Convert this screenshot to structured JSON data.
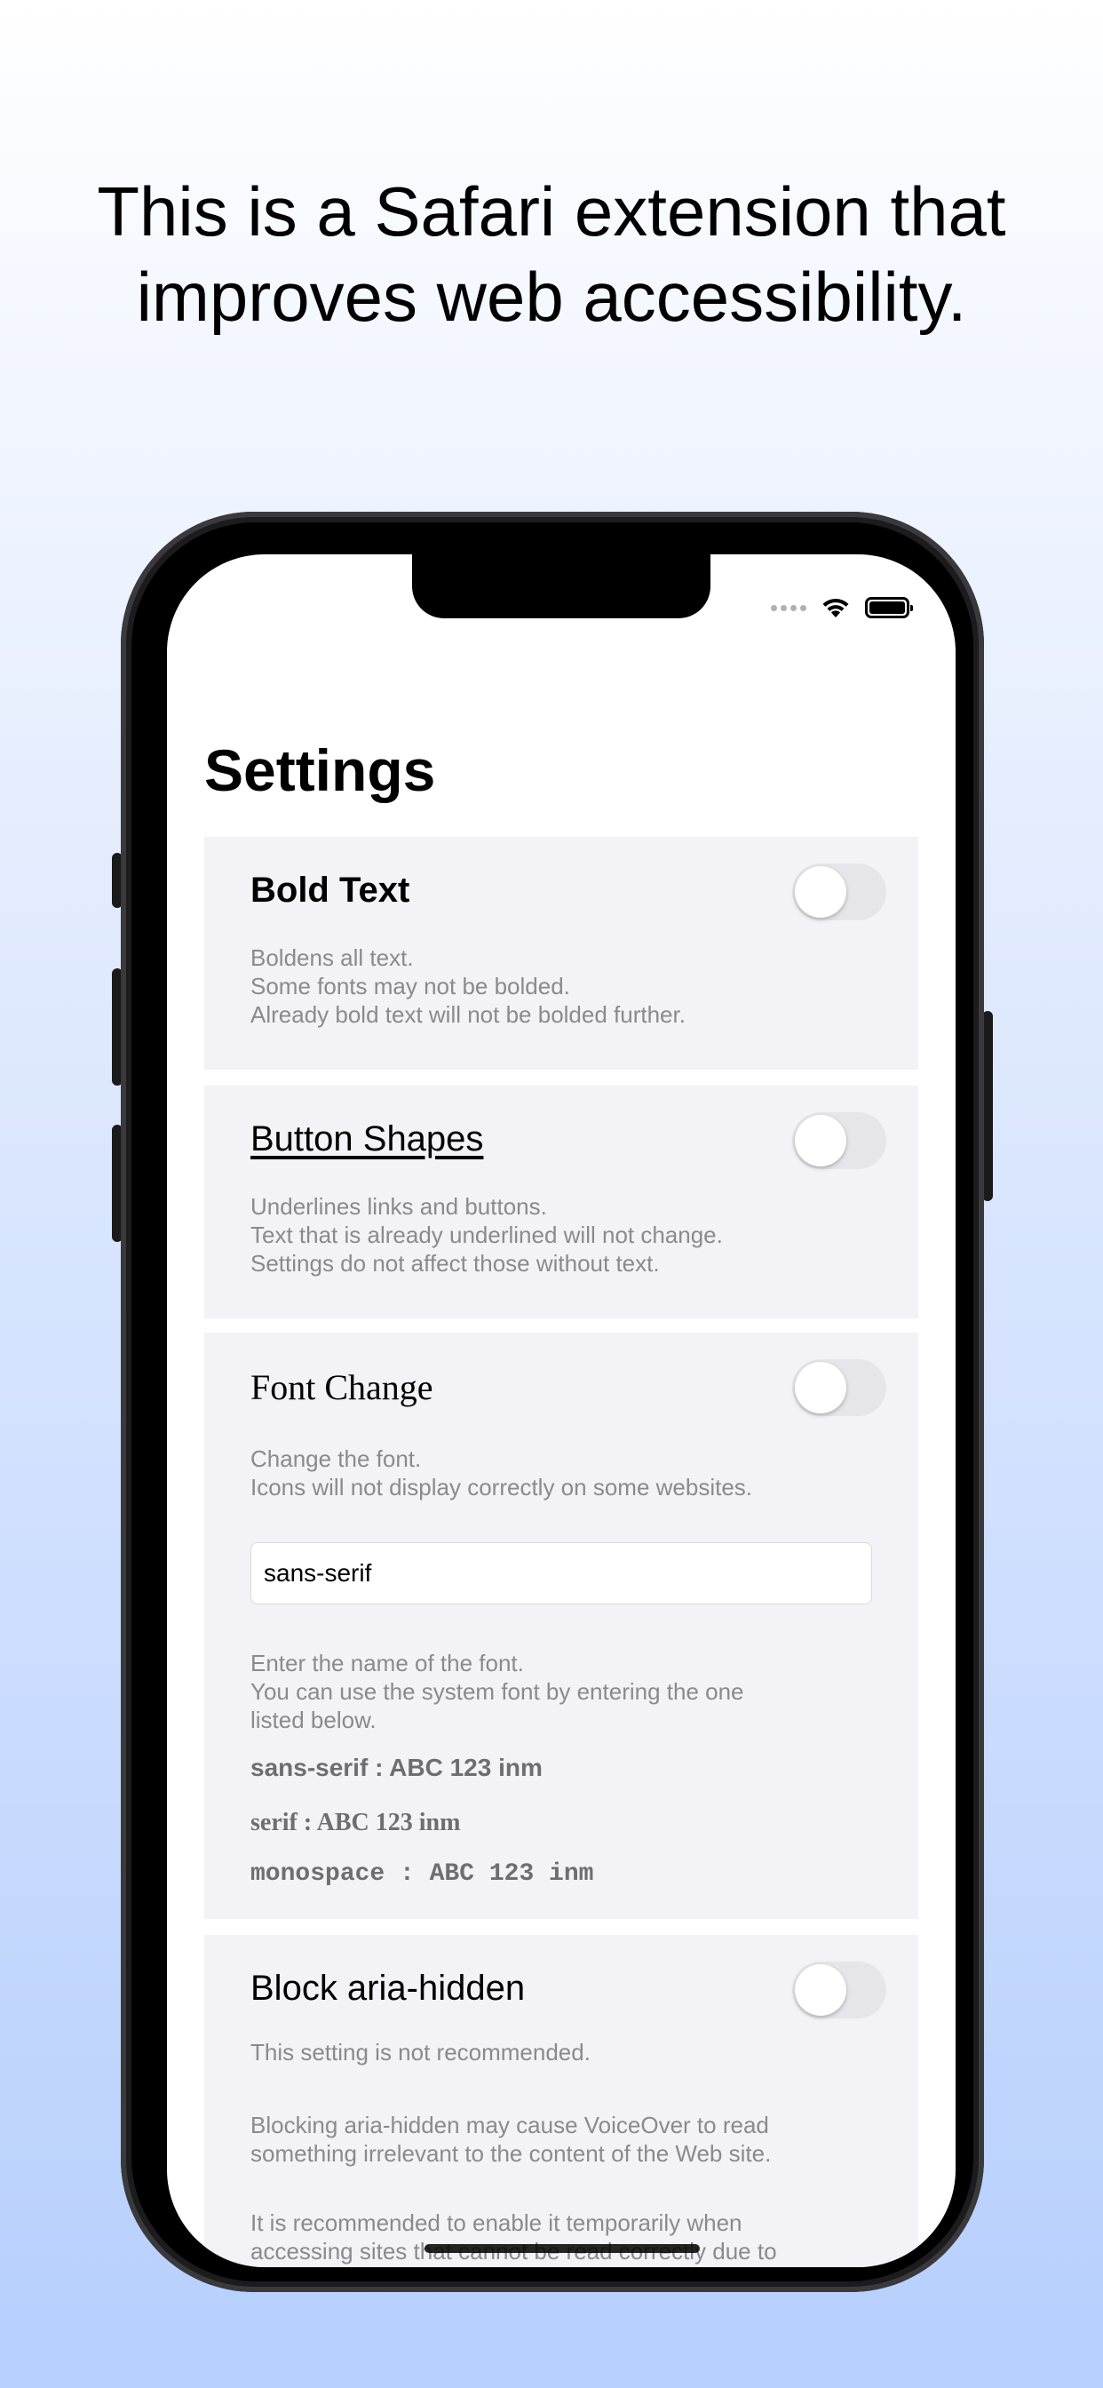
{
  "headline": {
    "line1": "This is a Safari extension that",
    "line2": "improves web accessibility."
  },
  "status_bar": {
    "signal_icon": "signal-dots-icon",
    "wifi_icon": "wifi-icon",
    "battery_icon": "battery-icon"
  },
  "page": {
    "title": "Settings"
  },
  "settings": {
    "bold_text": {
      "title": "Bold Text",
      "enabled": false,
      "description": "Boldens all text.\nSome fonts may not be bolded.\nAlready bold text will not be bolded further."
    },
    "button_shapes": {
      "title": "Button Shapes",
      "enabled": false,
      "description": "Underlines links and buttons.\nText that is already underlined will not change.\nSettings do not affect those without text."
    },
    "font_change": {
      "title": "Font Change",
      "enabled": false,
      "description": "Change the font.\nIcons will not display correctly on some websites.",
      "input_value": "sans-serif",
      "hint": "Enter the name of the font.\nYou can use the system font by entering the one\nlisted below.",
      "samples": {
        "sans_serif": "sans-serif : ABC 123 inm",
        "serif": "serif : ABC 123 inm",
        "monospace": "monospace : ABC 123 inm"
      }
    },
    "block_aria_hidden": {
      "title": "Block aria-hidden",
      "enabled": false,
      "description": "This setting is not recommended.",
      "warning": "Blocking aria-hidden may cause VoiceOver to read\nsomething irrelevant to the content of the Web site.",
      "note": "It is recommended to enable it temporarily when\naccessing sites that cannot be read correctly due to"
    }
  },
  "colors": {
    "card_background": "#f2f2f7",
    "toggle_off": "#e5e5ea",
    "secondary_text": "#8a8a8e",
    "gradient_bottom": "#b6cffd"
  }
}
